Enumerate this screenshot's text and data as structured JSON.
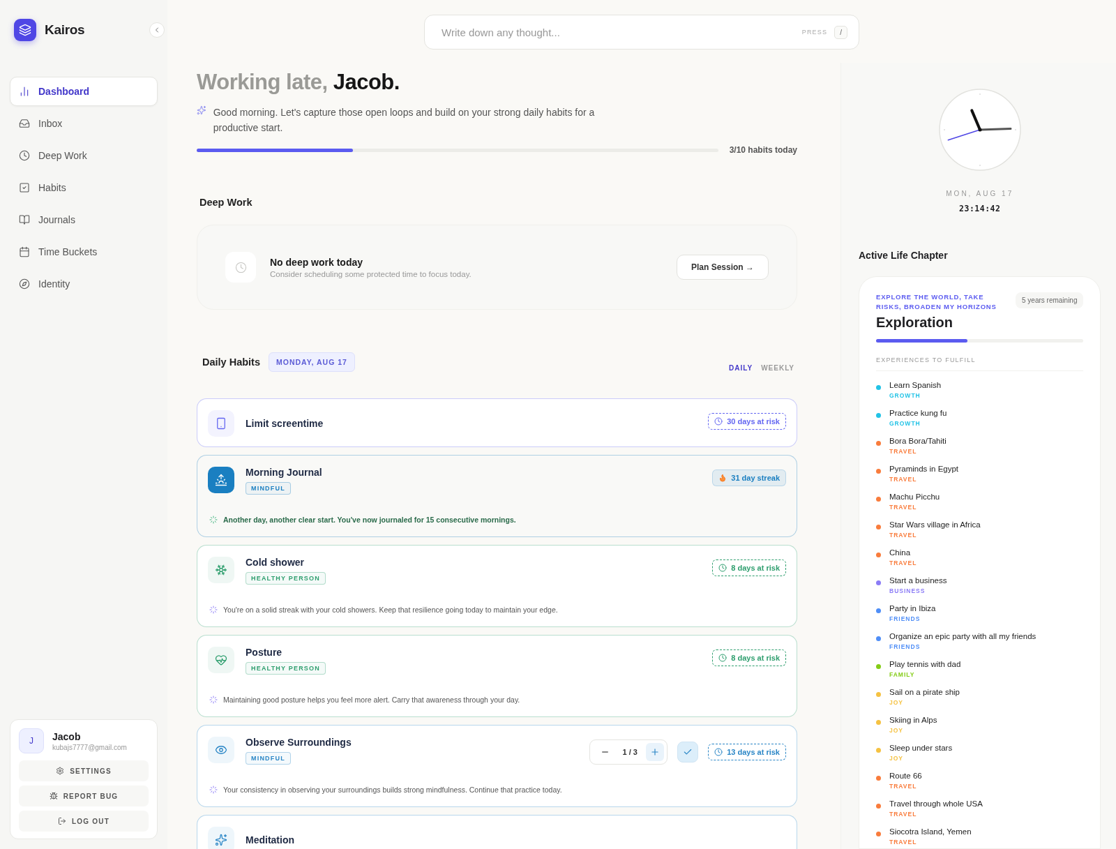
{
  "app": {
    "name": "Kairos"
  },
  "nav": [
    {
      "label": "Dashboard",
      "selected": true
    },
    {
      "label": "Inbox",
      "selected": false
    },
    {
      "label": "Deep Work",
      "selected": false
    },
    {
      "label": "Habits",
      "selected": false
    },
    {
      "label": "Journals",
      "selected": false
    },
    {
      "label": "Time Buckets",
      "selected": false
    },
    {
      "label": "Identity",
      "selected": false
    }
  ],
  "user": {
    "initial": "J",
    "name": "Jacob",
    "email": "kubajs7777@gmail.com",
    "actions": [
      "SETTINGS",
      "REPORT BUG",
      "LOG OUT"
    ]
  },
  "search": {
    "placeholder": "Write down any thought...",
    "hint": "PRESS",
    "key": "/"
  },
  "greeting": {
    "prefix": "Working late,",
    "name": "Jacob.",
    "message": "Good morning. Let's capture those open loops and build on your strong daily habits for a productive start.",
    "level": 0.3,
    "progress_label": "3/10 habits today"
  },
  "deep_work": {
    "heading": "Deep Work",
    "title": "No deep work today",
    "subtitle": "Consider scheduling some protected time to focus today.",
    "button": "Plan Session →"
  },
  "daily_habits": {
    "heading": "Daily Habits",
    "date": "MONDAY, AUG 17",
    "views": [
      {
        "label": "DAILY",
        "selected": true
      },
      {
        "label": "WEEKLY",
        "selected": false
      }
    ],
    "habits": [
      {
        "title": "Limit screentime",
        "color": "#6366f1",
        "completed": false,
        "badge": {
          "kind": "risk",
          "text": "30 days at risk"
        }
      },
      {
        "title": "Morning Journal",
        "color": "#1a7fc1",
        "tag": "MINDFUL",
        "completed": true,
        "badge": {
          "kind": "streak",
          "text": "31 day streak"
        },
        "note": "Another day, another clear start. You've now journaled for 15 consecutive mornings."
      },
      {
        "title": "Cold shower",
        "color": "#2e9e6e",
        "tag": "HEALTHY PERSON",
        "completed": false,
        "badge": {
          "kind": "risk",
          "text": "8 days at risk"
        },
        "note": "You're on a solid streak with your cold showers. Keep that resilience going today to maintain your edge."
      },
      {
        "title": "Posture",
        "color": "#2e9e6e",
        "tag": "HEALTHY PERSON",
        "completed": false,
        "badge": {
          "kind": "risk",
          "text": "8 days at risk"
        },
        "note": "Maintaining good posture helps you feel more alert. Carry that awareness through your day."
      },
      {
        "title": "Observe Surroundings",
        "color": "#2a86c6",
        "tag": "MINDFUL",
        "completed": false,
        "counter": "1 / 3",
        "badge": {
          "kind": "risk",
          "text": "13 days at risk"
        },
        "note": "Your consistency in observing your surroundings builds strong mindfulness. Continue that practice today."
      },
      {
        "title": "Meditation",
        "color": "#2a86c6",
        "completed": false
      }
    ]
  },
  "clock": {
    "date": "MON, AUG 17",
    "time": "23:14:42"
  },
  "life_chapter": {
    "heading": "Active Life Chapter",
    "theme": "EXPLORE THE WORLD, TAKE RISKS, BROADEN MY HORIZONS",
    "remaining": "5 years remaining",
    "title": "Exploration",
    "level": 0.44,
    "list_heading": "EXPERIENCES TO FULFILL",
    "experiences": [
      {
        "name": "Learn Spanish",
        "category": "GROWTH",
        "color": "#22c3e6"
      },
      {
        "name": "Practice kung fu",
        "category": "GROWTH",
        "color": "#22c3e6"
      },
      {
        "name": "Bora Bora/Tahiti",
        "category": "TRAVEL",
        "color": "#f97c3c"
      },
      {
        "name": "Pyraminds in Egypt",
        "category": "TRAVEL",
        "color": "#f97c3c"
      },
      {
        "name": "Machu Picchu",
        "category": "TRAVEL",
        "color": "#f97c3c"
      },
      {
        "name": "Star Wars village in Africa",
        "category": "TRAVEL",
        "color": "#f97c3c"
      },
      {
        "name": "China",
        "category": "TRAVEL",
        "color": "#f97c3c"
      },
      {
        "name": "Start a business",
        "category": "BUSINESS",
        "color": "#8b7cf6"
      },
      {
        "name": "Party in Ibiza",
        "category": "FRIENDS",
        "color": "#4f8ef7"
      },
      {
        "name": "Organize an epic party with all my friends",
        "category": "FRIENDS",
        "color": "#4f8ef7"
      },
      {
        "name": "Play tennis with dad",
        "category": "FAMILY",
        "color": "#84cc16"
      },
      {
        "name": "Sail on a pirate ship",
        "category": "JOY",
        "color": "#f5c242"
      },
      {
        "name": "Skiing in Alps",
        "category": "JOY",
        "color": "#f5c242"
      },
      {
        "name": "Sleep under stars",
        "category": "JOY",
        "color": "#f5c242"
      },
      {
        "name": "Route 66",
        "category": "TRAVEL",
        "color": "#f97c3c"
      },
      {
        "name": "Travel through whole USA",
        "category": "TRAVEL",
        "color": "#f97c3c"
      },
      {
        "name": "Siocotra Island, Yemen",
        "category": "TRAVEL",
        "color": "#f97c3c"
      }
    ]
  }
}
